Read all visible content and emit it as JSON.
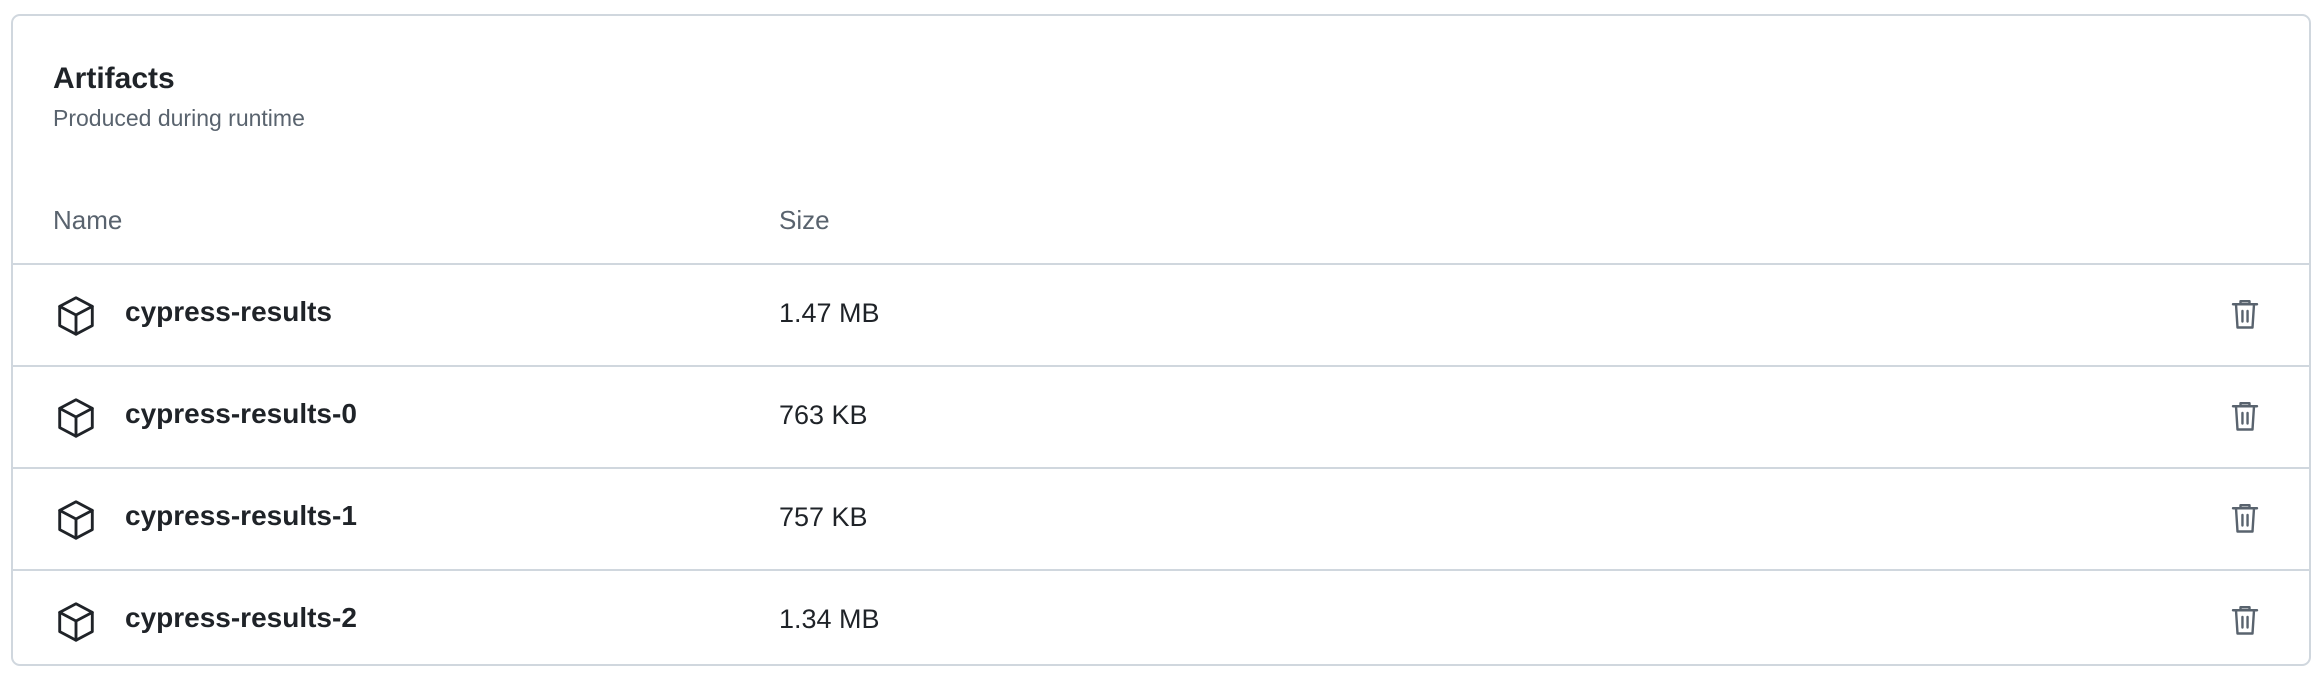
{
  "artifacts": {
    "title": "Artifacts",
    "subtitle": "Produced during runtime",
    "columns": {
      "name": "Name",
      "size": "Size"
    },
    "items": [
      {
        "name": "cypress-results",
        "size": "1.47 MB",
        "icon": "package-icon",
        "action_icon": "trash-icon"
      },
      {
        "name": "cypress-results-0",
        "size": "763 KB",
        "icon": "package-icon",
        "action_icon": "trash-icon"
      },
      {
        "name": "cypress-results-1",
        "size": "757 KB",
        "icon": "package-icon",
        "action_icon": "trash-icon"
      },
      {
        "name": "cypress-results-2",
        "size": "1.34 MB",
        "icon": "package-icon",
        "action_icon": "trash-icon"
      }
    ]
  },
  "colors": {
    "text_primary": "#1f2328",
    "text_muted": "#59636e",
    "border": "#d0d7de"
  }
}
